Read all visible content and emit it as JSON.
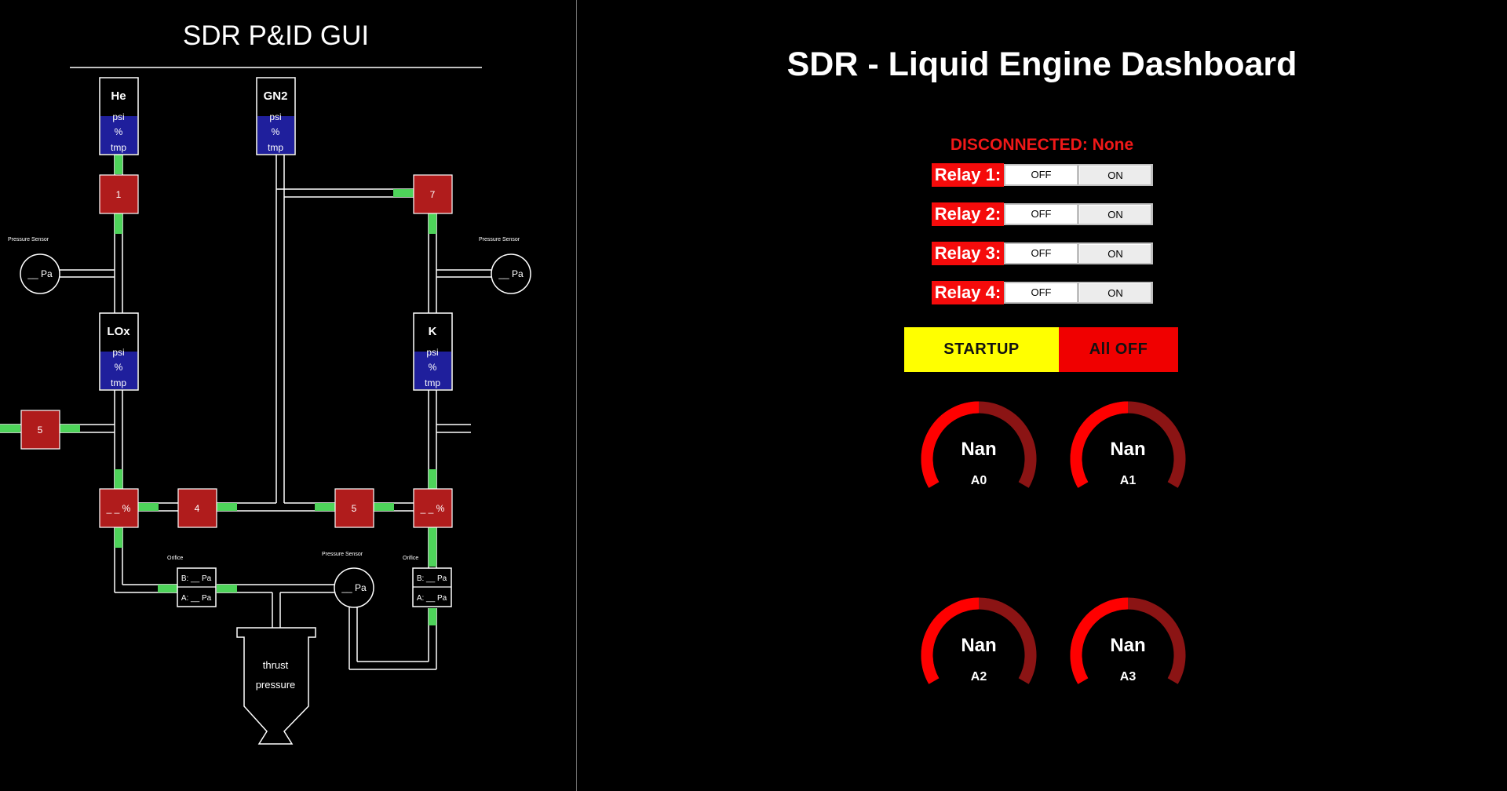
{
  "pid": {
    "title": "SDR P&ID GUI",
    "tanks": [
      {
        "name": "He",
        "lines": [
          "psi",
          "%",
          "tmp"
        ]
      },
      {
        "name": "GN2",
        "lines": [
          "psi",
          "%",
          "tmp"
        ]
      },
      {
        "name": "LOx",
        "lines": [
          "psi",
          "%",
          "tmp"
        ]
      },
      {
        "name": "K",
        "lines": [
          "psi",
          "%",
          "tmp"
        ]
      }
    ],
    "valves": [
      "1",
      "7",
      "5",
      "4",
      "5",
      "_ _ %",
      "_ _ %"
    ],
    "pressure_sensor_label": "Pressure Sensor",
    "sensor_readout": "__ Pa",
    "orifice_label": "Orifice",
    "orifice_b": "B: __ Pa",
    "orifice_a": "A: __ Pa",
    "nozzle_text_1": "thrust",
    "nozzle_text_2": "pressure",
    "colors": {
      "valve": "#b01c1c",
      "tank_fill": "#1f1f9c",
      "pipe_highlight": "#4ed35a"
    }
  },
  "dashboard": {
    "title": "SDR - Liquid Engine Dashboard",
    "status": "DISCONNECTED: None",
    "relays": [
      {
        "label": "Relay 1:",
        "off": "OFF",
        "on": "ON"
      },
      {
        "label": "Relay 2:",
        "off": "OFF",
        "on": "ON"
      },
      {
        "label": "Relay 3:",
        "off": "OFF",
        "on": "ON"
      },
      {
        "label": "Relay 4:",
        "off": "OFF",
        "on": "ON"
      }
    ],
    "startup_label": "STARTUP",
    "alloff_label": "All OFF",
    "gauges": [
      {
        "value": "Nan",
        "name": "A0",
        "fill_fraction": 0.5
      },
      {
        "value": "Nan",
        "name": "A1",
        "fill_fraction": 0.5
      },
      {
        "value": "Nan",
        "name": "A2",
        "fill_fraction": 0.5
      },
      {
        "value": "Nan",
        "name": "A3",
        "fill_fraction": 0.5
      }
    ],
    "colors": {
      "relay_label": "#f50b0b",
      "startup": "#ffff00",
      "alloff": "#f00000",
      "gauge_fill": "#ff0000",
      "gauge_track": "#8b1414",
      "status": "#f01818"
    }
  }
}
